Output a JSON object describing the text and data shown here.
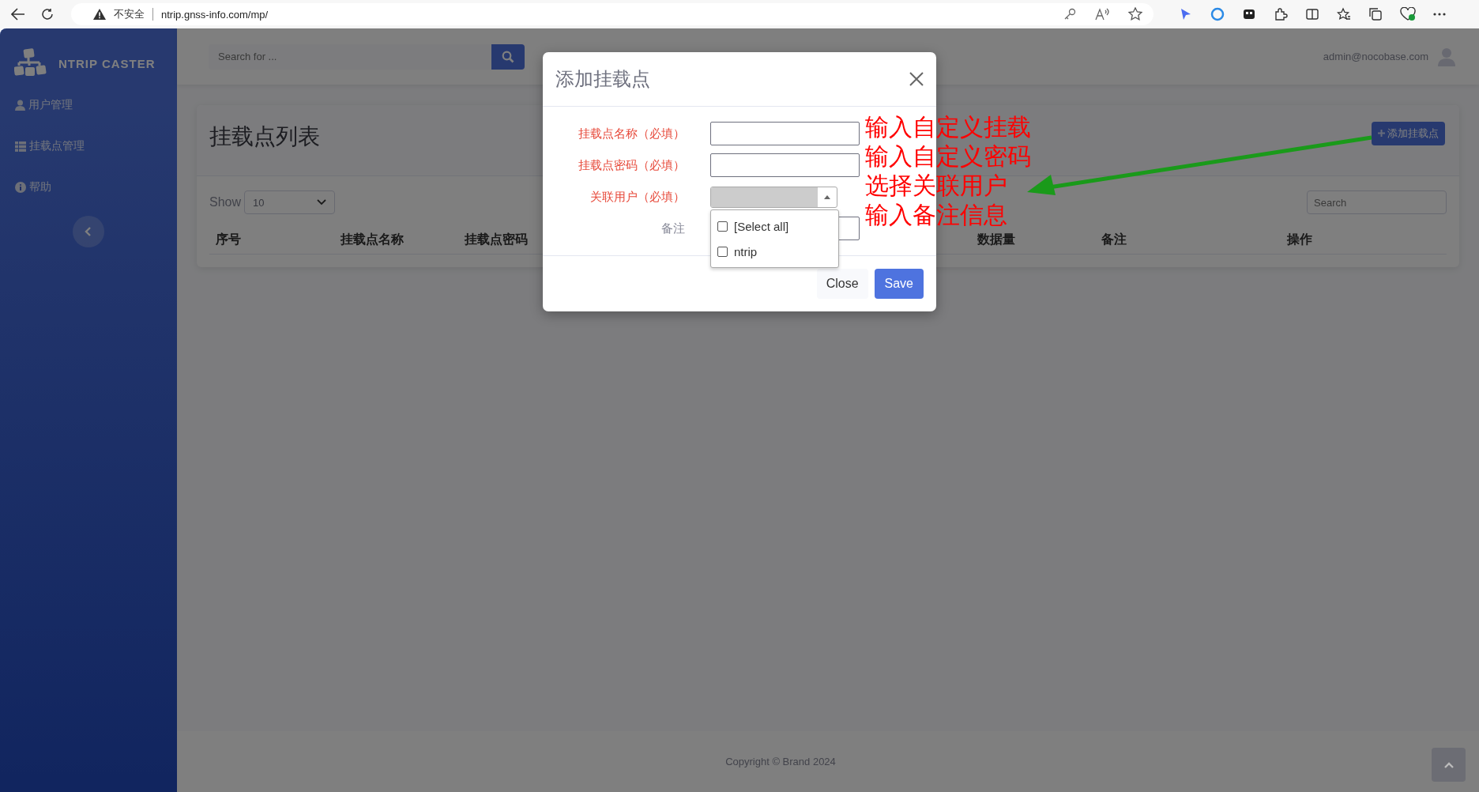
{
  "browser": {
    "security_label": "不安全",
    "url": "ntrip.gnss-info.com/mp/"
  },
  "sidebar": {
    "brand": "NTRIP CASTER",
    "items": [
      {
        "label": "用户管理",
        "kind": "user"
      },
      {
        "label": "挂载点管理",
        "kind": "table"
      },
      {
        "label": "帮助",
        "kind": "info"
      }
    ]
  },
  "topbar": {
    "search_placeholder": "Search for ...",
    "user": "admin@nocobase.com"
  },
  "page": {
    "title": "挂载点列表",
    "add_button": "添加挂载点",
    "show_label": "Show",
    "page_size": "10",
    "search_placeholder": "Search",
    "columns": [
      {
        "label": "序号"
      },
      {
        "label": "挂载点名称"
      },
      {
        "label": "挂载点密码"
      },
      {
        "label": "数据量"
      },
      {
        "label": "备注"
      },
      {
        "label": "操作"
      }
    ]
  },
  "modal": {
    "title": "添加挂载点",
    "fields": [
      {
        "label": "挂载点名称（必填）",
        "required": true,
        "kind": "input"
      },
      {
        "label": "挂载点密码（必填）",
        "required": true,
        "kind": "input"
      },
      {
        "label": "关联用户（必填）",
        "required": true,
        "kind": "select"
      },
      {
        "label": "备注",
        "required": false,
        "kind": "input"
      }
    ],
    "dropdown_options": [
      {
        "label": "[Select all]",
        "checked": false
      },
      {
        "label": "ntrip",
        "checked": false
      }
    ],
    "close_button": "Close",
    "save_button": "Save"
  },
  "annotations": [
    "输入自定义挂载",
    "输入自定义密码",
    "选择关联用户",
    "输入备注信息"
  ],
  "footer": {
    "copyright": "Copyright © Brand 2024"
  }
}
